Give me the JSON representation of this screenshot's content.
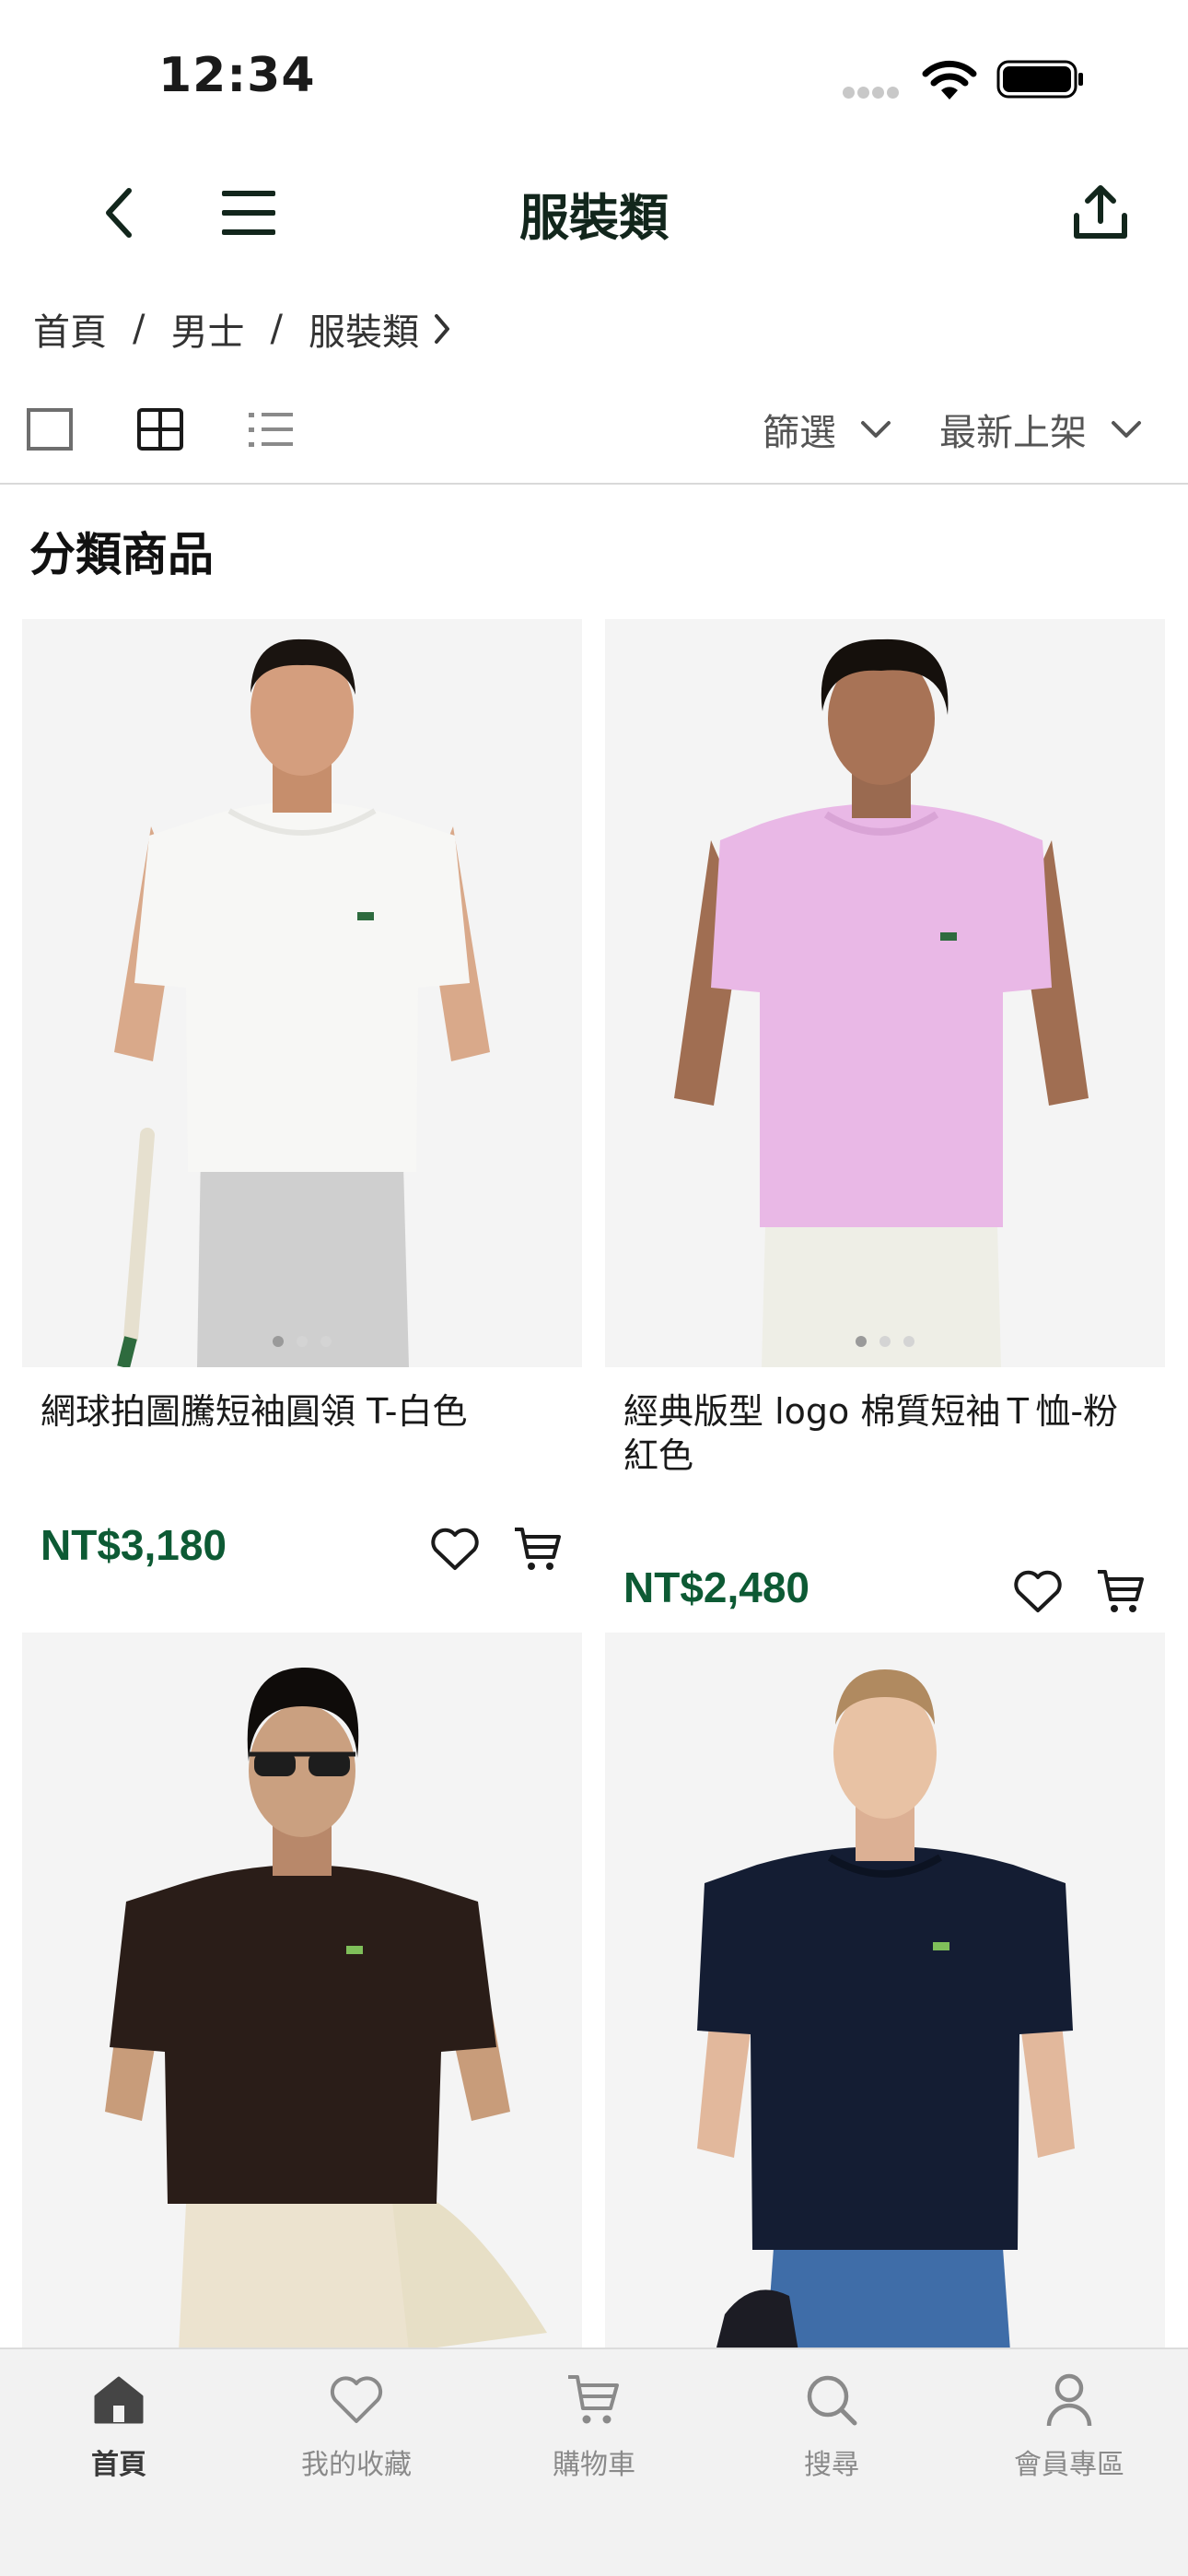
{
  "status_bar": {
    "time": "12:34"
  },
  "nav": {
    "title": "服裝類",
    "back_icon": "chevron-left-icon",
    "menu_icon": "hamburger-icon",
    "share_icon": "share-icon"
  },
  "breadcrumb": {
    "items": [
      "首頁",
      "男士",
      "服裝類"
    ],
    "separator": "/"
  },
  "toolbar": {
    "view_modes": [
      "single-view-icon",
      "grid-view-icon",
      "list-view-icon"
    ],
    "filter_label": "篩選",
    "sort_label": "最新上架"
  },
  "section": {
    "title": "分類商品"
  },
  "products": [
    {
      "name": "網球拍圖騰短袖圓領 T-白色",
      "price": "NT$3,180",
      "shirt_color": "#f7f7f5",
      "pants_color": "#cfcfcf"
    },
    {
      "name": "經典版型 logo 棉質短袖Ｔ恤-粉紅色",
      "price": "NT$2,480",
      "shirt_color": "#e9b8e6",
      "pants_color": "#eeeee6"
    },
    {
      "name": "",
      "price": "",
      "shirt_color": "#2a1d18",
      "pants_color": "#ece3cf"
    },
    {
      "name": "",
      "price": "",
      "shirt_color": "#141d33",
      "pants_color": "#3f6da8"
    }
  ],
  "tab_bar": {
    "items": [
      {
        "label": "首頁",
        "icon": "home-icon",
        "active": true
      },
      {
        "label": "我的收藏",
        "icon": "heart-icon",
        "active": false
      },
      {
        "label": "購物車",
        "icon": "cart-icon",
        "active": false
      },
      {
        "label": "搜尋",
        "icon": "search-icon",
        "active": false
      },
      {
        "label": "會員專區",
        "icon": "user-icon",
        "active": false
      }
    ]
  },
  "colors": {
    "brand_green": "#0d5a34",
    "title_dark": "#12261c",
    "tab_active": "#3a3a3a",
    "tab_inactive": "#8a8a8a"
  }
}
